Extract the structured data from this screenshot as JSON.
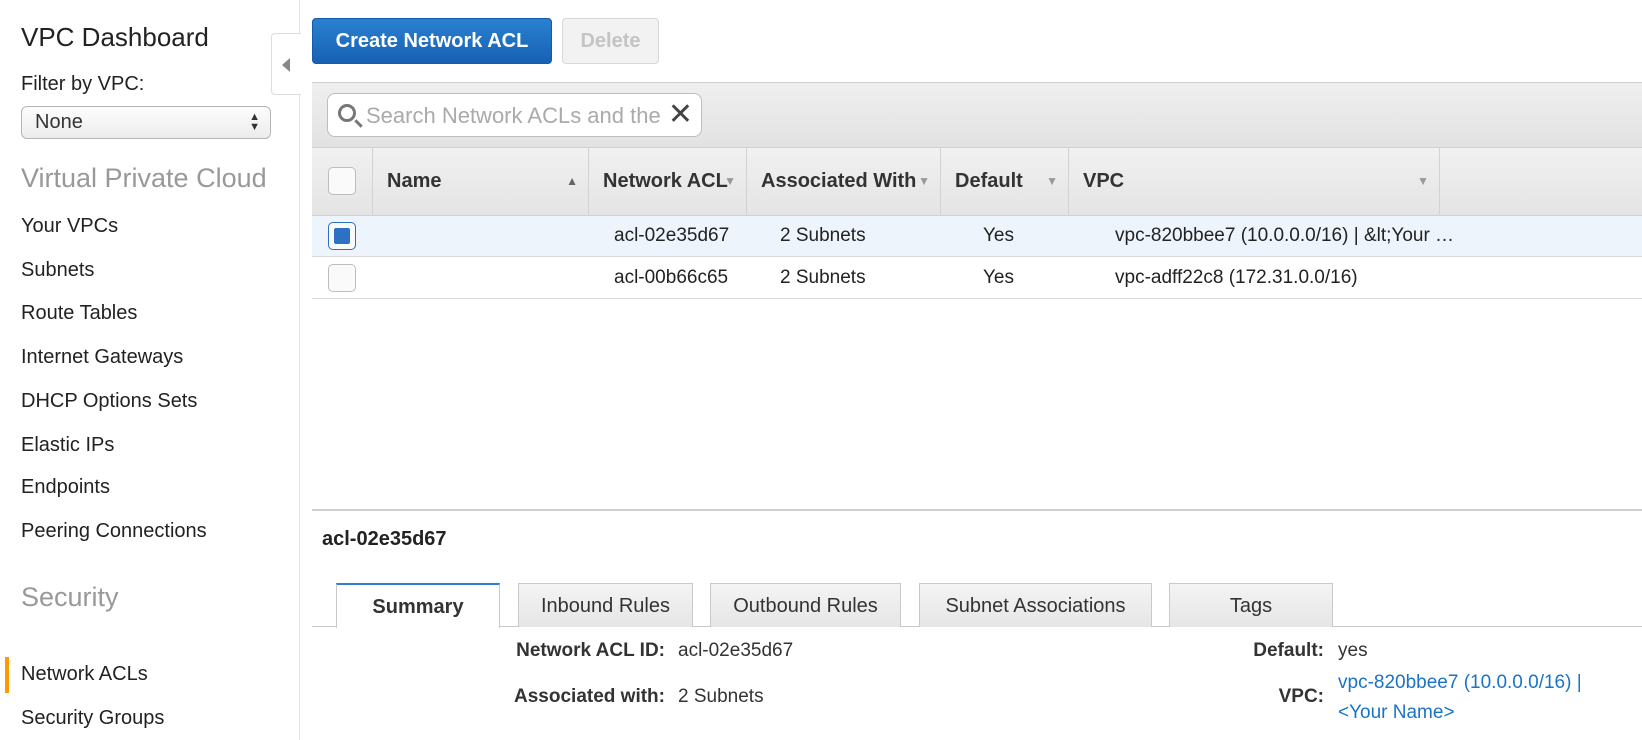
{
  "sidebar": {
    "title": "VPC Dashboard",
    "filter_label": "Filter by VPC:",
    "filter_value": "None",
    "sections": [
      {
        "heading": "Virtual Private Cloud",
        "items": [
          "Your VPCs",
          "Subnets",
          "Route Tables",
          "Internet Gateways",
          "DHCP Options Sets",
          "Elastic IPs",
          "Endpoints",
          "Peering Connections"
        ]
      },
      {
        "heading": "Security",
        "items": [
          "Network ACLs",
          "Security Groups"
        ]
      }
    ],
    "active_item": "Network ACLs"
  },
  "toolbar": {
    "create_label": "Create Network ACL",
    "delete_label": "Delete"
  },
  "search": {
    "placeholder": "Search Network ACLs and their properties",
    "value": ""
  },
  "table": {
    "columns": [
      "Name",
      "Network ACL",
      "Associated With",
      "Default",
      "VPC"
    ],
    "rows": [
      {
        "selected": true,
        "name": "",
        "acl": "acl-02e35d67",
        "assoc": "2 Subnets",
        "default": "Yes",
        "vpc": "vpc-820bbee7 (10.0.0.0/16) | &lt;Your …"
      },
      {
        "selected": false,
        "name": "",
        "acl": "acl-00b66c65",
        "assoc": "2 Subnets",
        "default": "Yes",
        "vpc": "vpc-adff22c8 (172.31.0.0/16)"
      }
    ]
  },
  "details": {
    "title": "acl-02e35d67",
    "tabs": [
      "Summary",
      "Inbound Rules",
      "Outbound Rules",
      "Subnet Associations",
      "Tags"
    ],
    "active_tab": "Summary",
    "summary": {
      "acl_id_label": "Network ACL ID:",
      "acl_id_value": "acl-02e35d67",
      "assoc_label": "Associated with:",
      "assoc_value": "2 Subnets",
      "default_label": "Default:",
      "default_value": "yes",
      "vpc_label": "VPC:",
      "vpc_value_line1": "vpc-820bbee7 (10.0.0.0/16) |",
      "vpc_value_line2": "<Your Name>"
    }
  },
  "colors": {
    "primary_button": "#1f6ec1",
    "active_indicator": "#ff9900",
    "link": "#1a73c7"
  },
  "icons": [
    "collapse-left-icon",
    "search-icon",
    "clear-icon",
    "sort-asc-icon",
    "sort-desc-icon",
    "select-arrows-icon"
  ]
}
